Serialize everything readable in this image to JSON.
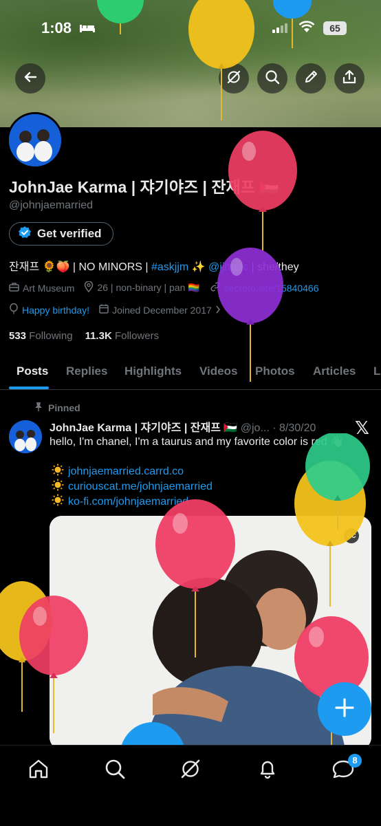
{
  "status_bar": {
    "time": "1:08",
    "battery": "65"
  },
  "profile": {
    "name": "JohnJae Karma | 쟈기야즈 | 잔재프 🇵🇸",
    "handle": "@johnjaemarried",
    "verify_label": "Get verified",
    "bio_prefix": "잔재프 🌻🍑 | NO MINORS | ",
    "bio_hashtag": "#askjjm",
    "bio_sparkle": " ✨ ",
    "bio_mention": "@jjmetc",
    "bio_suffix": " | she/they",
    "category": "Art Museum",
    "location": "26 | non-binary | pan 🏳️‍🌈",
    "website": "secreto.site/15840466",
    "birthday": "Happy birthday!",
    "joined": "Joined December 2017",
    "following_count": "533",
    "following_label": "Following",
    "followers_count": "11.3K",
    "followers_label": "Followers"
  },
  "tabs": [
    "Posts",
    "Replies",
    "Highlights",
    "Videos",
    "Photos",
    "Articles",
    "L"
  ],
  "post": {
    "pinned_label": "Pinned",
    "author": "JohnJae Karma | 쟈기야즈 | 잔재프 🇵🇸",
    "handle_date": " @jo... · 8/30/20",
    "text": "hello, I'm chanel, I'm a taurus and my favorite color is red 👋🏽",
    "links": [
      "johnjaemarried.carrd.co",
      "curiouscat.me/johnjaemarried",
      "ko-fi.com/johnjaemarried"
    ]
  },
  "nav": {
    "messages_badge": "8"
  },
  "icons": [
    "back-arrow-icon",
    "grok-icon",
    "search-icon",
    "edit-icon",
    "share-icon",
    "verified-icon",
    "briefcase-icon",
    "location-pin-icon",
    "link-icon",
    "balloon-icon",
    "calendar-icon",
    "pin-icon",
    "x-logo-icon",
    "sun-icon",
    "cc-icon",
    "plus-icon",
    "home-icon",
    "explore-icon",
    "grok-nav-icon",
    "bell-icon",
    "messages-icon"
  ],
  "colors": {
    "accent": "#1d9bf0",
    "background": "#000000",
    "muted": "#71767b",
    "text": "#e7e9ea"
  }
}
